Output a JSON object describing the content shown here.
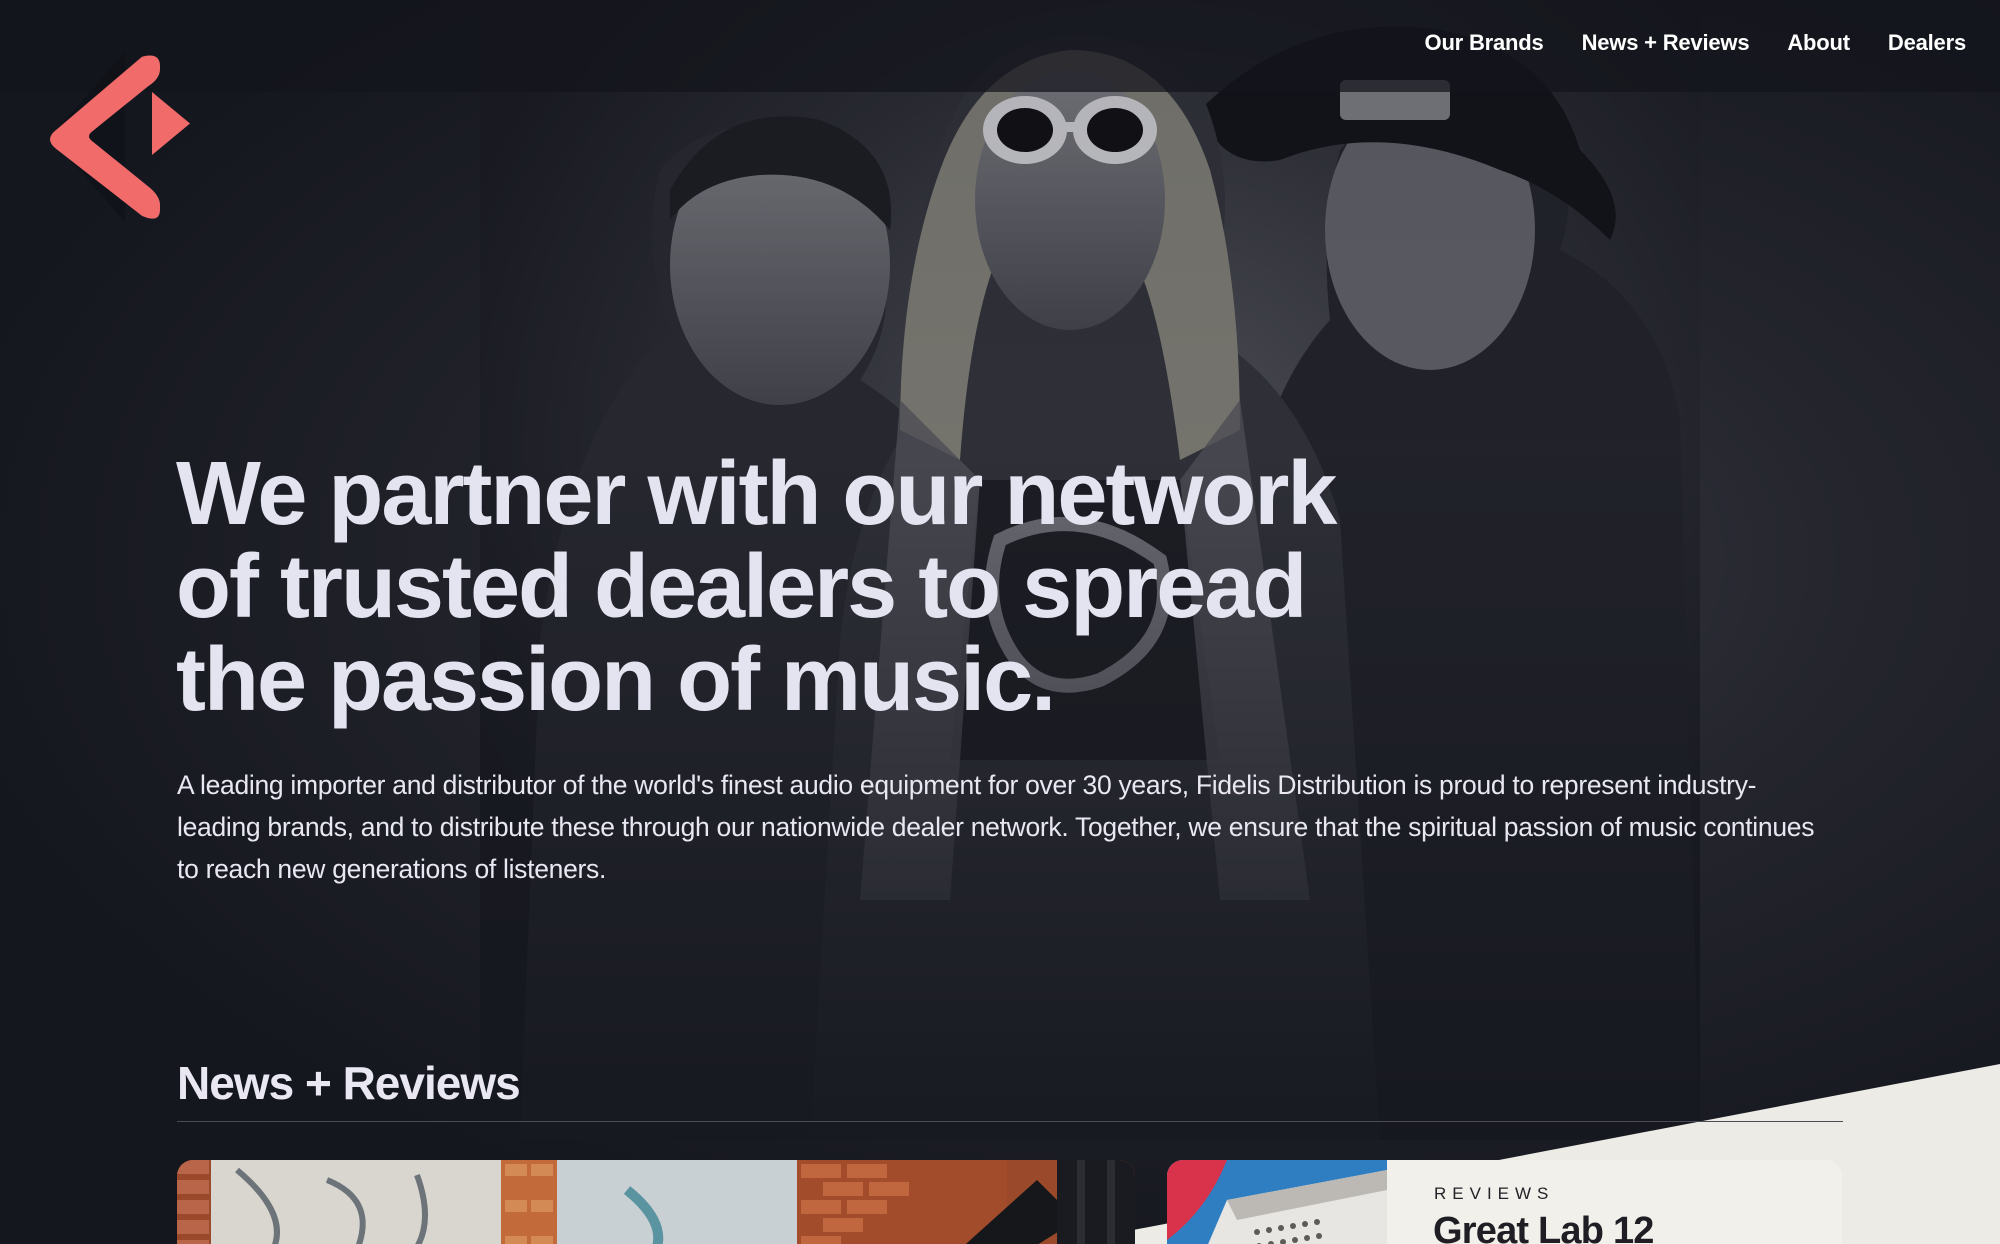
{
  "brand": {
    "logo_icon": "fidelis-logo-icon",
    "accent_color": "#f26b6b"
  },
  "nav": {
    "items": [
      {
        "label": "Our Brands"
      },
      {
        "label": "News + Reviews"
      },
      {
        "label": "About"
      },
      {
        "label": "Dealers"
      }
    ]
  },
  "hero": {
    "headline_lines": [
      "We partner with our network",
      "of trusted dealers to spread",
      "the passion of music."
    ],
    "intro": "A leading importer and distributor of the world's finest audio equipment for over 30 years, Fidelis Distribution is proud to represent industry-leading brands, and to distribute these through our nationwide dealer network. Together, we ensure that the spiritual passion of music continues to reach new generations of listeners."
  },
  "news": {
    "section_title": "News + Reviews",
    "featured_card": {
      "image": "graffiti-wall-photo"
    },
    "review_card": {
      "kicker": "REVIEWS",
      "title": "Great Lab 12",
      "image": "speaker-product-photo"
    }
  },
  "colors": {
    "background": "#15171f",
    "light_section": "#ecebe5",
    "text": "#e4e3f0"
  }
}
